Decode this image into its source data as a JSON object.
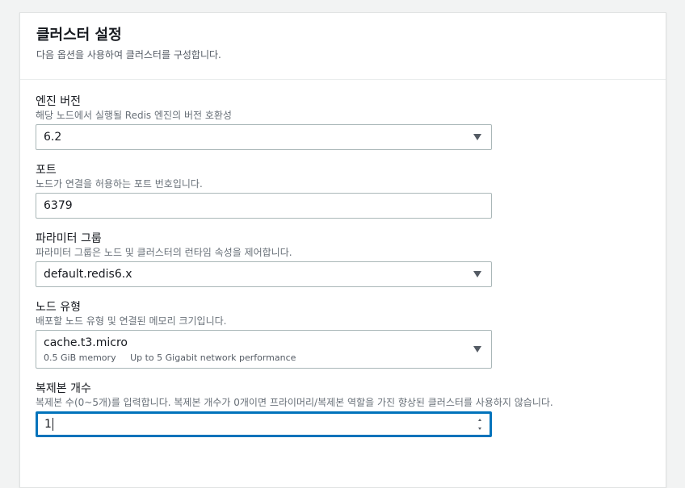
{
  "header": {
    "title": "클러스터 설정",
    "subtitle": "다음 옵션을 사용하여 클러스터를 구성합니다."
  },
  "fields": {
    "engine_version": {
      "label": "엔진 버전",
      "description": "해당 노드에서 실행될 Redis 엔진의 버전 호환성",
      "value": "6.2"
    },
    "port": {
      "label": "포트",
      "description": "노드가 연결을 허용하는 포트 번호입니다.",
      "value": "6379"
    },
    "parameter_group": {
      "label": "파라미터 그룹",
      "description": "파라미터 그룹은 노드 및 클러스터의 런타임 속성을 제어합니다.",
      "value": "default.redis6.x"
    },
    "node_type": {
      "label": "노드 유형",
      "description": "배포할 노드 유형 및 연결된 메모리 크기입니다.",
      "value": "cache.t3.micro",
      "memory": "0.5 GiB memory",
      "network": "Up to 5 Gigabit network performance"
    },
    "replicas": {
      "label": "복제본 개수",
      "description": "복제본 수(0~5개)를 입력합니다. 복제본 개수가 0개이면 프라이머리/복제본 역할을 가진 향상된 클러스터를 사용하지 않습니다.",
      "value": "1"
    }
  },
  "icons": {
    "dropdown": "caret-down-icon",
    "stepper": "spinner-icon"
  },
  "colors": {
    "focus": "#0073bb",
    "border": "#aab7b8",
    "background": "#f2f3f3"
  }
}
